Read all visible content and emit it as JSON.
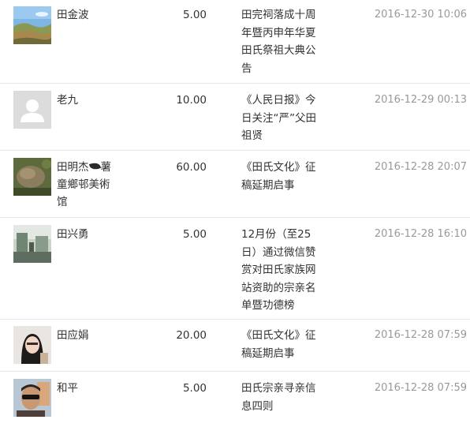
{
  "donations": [
    {
      "name": "田金波",
      "amount": "5.00",
      "article": "田完祠落成十周年暨丙申年华夏田氏祭祖大典公告",
      "time": "2016-12-30 10:06",
      "avatar": "landscape-photo"
    },
    {
      "name": "老九",
      "amount": "10.00",
      "article": "《人民日报》今日关注“严”父田祖贤",
      "time": "2016-12-29 00:13",
      "avatar": "default-user-icon"
    },
    {
      "name_a": "田明杰",
      "name_b": "薯童鄉邨美術馆",
      "amount": "60.00",
      "article": "《田氏文化》征稿延期启事",
      "time": "2016-12-28 20:07",
      "avatar": "rock-garden-photo"
    },
    {
      "name": "田兴勇",
      "amount": "5.00",
      "article": "12月份（至25日）通过微信赞赏对田氏家族网站资助的宗亲名单暨功德榜",
      "time": "2016-12-28 16:10",
      "avatar": "courtyard-photo"
    },
    {
      "name": "田应娟",
      "amount": "20.00",
      "article": "《田氏文化》征稿延期启事",
      "time": "2016-12-28 07:59",
      "avatar": "portrait-woman-photo"
    },
    {
      "name": "和平",
      "amount": "5.00",
      "article": "田氏宗亲寻亲信息四则",
      "time": "2016-12-28 07:59",
      "avatar": "portrait-man-sunglasses-photo"
    }
  ]
}
